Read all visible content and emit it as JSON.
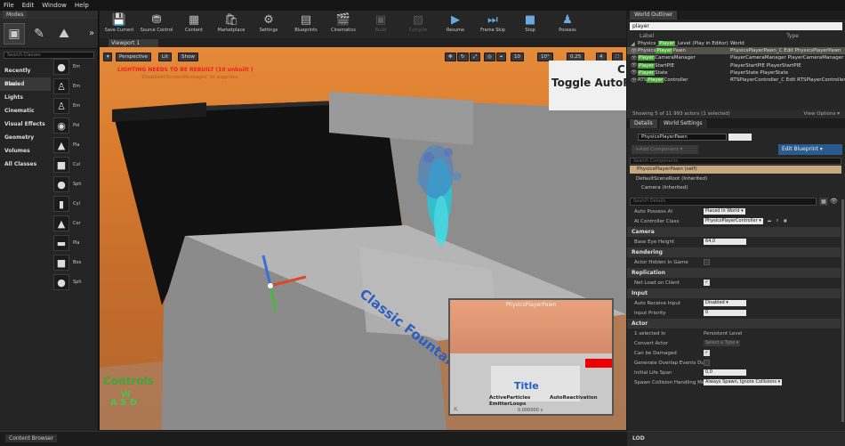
{
  "menu": [
    "File",
    "Edit",
    "Window",
    "Help"
  ],
  "modes": {
    "tab": "Modes",
    "search_placeholder": "Search Classes",
    "categories": [
      "Recently Placed",
      "Basic",
      "Lights",
      "Cinematic",
      "Visual Effects",
      "Geometry",
      "Volumes",
      "All Classes"
    ],
    "items": [
      {
        "icon": "●",
        "label": "Em"
      },
      {
        "icon": "♙",
        "label": "Em"
      },
      {
        "icon": "♙",
        "label": "Em"
      },
      {
        "icon": "◉",
        "label": "Poi"
      },
      {
        "icon": "▲",
        "label": "Pla"
      },
      {
        "icon": "■",
        "label": "Cul"
      },
      {
        "icon": "●",
        "label": "Sph"
      },
      {
        "icon": "▮",
        "label": "Cyl"
      },
      {
        "icon": "▲",
        "label": "Cor"
      },
      {
        "icon": "▬",
        "label": "Pla"
      },
      {
        "icon": "■",
        "label": "Box"
      },
      {
        "icon": "●",
        "label": "Sph"
      }
    ]
  },
  "toolbar": [
    {
      "icon": "💾",
      "label": "Save Current",
      "enabled": true
    },
    {
      "icon": "⛃",
      "label": "Source Control",
      "enabled": true
    },
    {
      "icon": "▦",
      "label": "Content",
      "enabled": true
    },
    {
      "icon": "🛍",
      "label": "Marketplace",
      "enabled": true
    },
    {
      "icon": "⚙",
      "label": "Settings",
      "enabled": true
    },
    {
      "icon": "▤",
      "label": "Blueprints",
      "enabled": true
    },
    {
      "icon": "🎬",
      "label": "Cinematics",
      "enabled": true
    },
    {
      "icon": "▣",
      "label": "Build",
      "enabled": false
    },
    {
      "icon": "▧",
      "label": "Compile",
      "enabled": false
    },
    {
      "icon": "▶",
      "label": "Resume",
      "enabled": true
    },
    {
      "icon": "⏭",
      "label": "Frame Skip",
      "enabled": true
    },
    {
      "icon": "■",
      "label": "Stop",
      "enabled": true
    },
    {
      "icon": "♟",
      "label": "Possess",
      "enabled": true
    }
  ],
  "viewport": {
    "tab": "Viewport 1",
    "perspective": "Perspective",
    "lit": "Lit",
    "show": "Show",
    "snap_move": "10",
    "snap_rot": "10°",
    "snap_scale": "0,25",
    "cam_speed": "4",
    "lighting_warning": "LIGHTING NEEDS TO BE REBUILT (10 unbuilt )",
    "lighting_sub": "'DisableAllScreenMessages' to suppress",
    "toggle_text": "Toggle AutoRe",
    "toggle_c": "C",
    "fountain_text": "Classic Fountai",
    "controls_title": "Controls",
    "wasd_w": "W",
    "wasd_asd": "A S D"
  },
  "pip": {
    "name": "PhysicsPlayerPawn",
    "title": "Title",
    "active_particles": "ActiveParticles",
    "emitter_loops": "EmitterLoops",
    "auto_reactivation": "AutoReactivation",
    "zero": "0,000000 s"
  },
  "outliner": {
    "tab": "World Outliner",
    "search": "player",
    "col_label": "Label",
    "col_type": "Type",
    "rows": [
      {
        "pre": "Physics_",
        "hl": "Player",
        "post": "_Level (Play in Editor)",
        "type": "World",
        "sel": false
      },
      {
        "pre": "Physics",
        "hl": "Player",
        "post": "Pawn",
        "type": "PhysicsPlayerPawn_C  Edit PhysicsPlayerPawn",
        "sel": true
      },
      {
        "pre": "",
        "hl": "Player",
        "post": "CameraManager",
        "type": "PlayerCameraManager  PlayerCameraManager",
        "sel": false
      },
      {
        "pre": "",
        "hl": "Player",
        "post": "StartPIE",
        "type": "PlayerStartPIE  PlayerStartPIE",
        "sel": false
      },
      {
        "pre": "",
        "hl": "Player",
        "post": "State",
        "type": "PlayerState  PlayerState",
        "sel": false
      },
      {
        "pre": "RTS",
        "hl": "Player",
        "post": "Controller",
        "type": "RTSPlayerController_C  Edit RTSPlayerController",
        "sel": false
      }
    ],
    "footer": "Showing 5 of 11 993 actors (1 selected)",
    "view_options": "View Options ▾"
  },
  "details": {
    "tab1": "Details",
    "tab2": "World Settings",
    "name": "PhysicsPlayerPawn",
    "add_component": "+Add Component ▾",
    "edit_blueprint": "Edit Blueprint ▾",
    "search_components": "Search Components",
    "self_comp": "PhysicsPlayerPawn (self)",
    "comp1": "DefaultSceneRoot (Inherited)",
    "comp2": "Camera (Inherited)",
    "search_details": "Search Details",
    "auto_possess_ai_k": "Auto Possess AI",
    "auto_possess_ai_v": "Placed in World ▾",
    "ai_controller_k": "AI Controller Class",
    "ai_controller_v": "PhysicsPlayerController ▾",
    "sec_camera": "Camera",
    "base_eye_k": "Base Eye Height",
    "base_eye_v": "64,0",
    "sec_rendering": "Rendering",
    "hidden_k": "Actor Hidden In Game",
    "sec_replication": "Replication",
    "net_load_k": "Net Load on Client",
    "sec_input": "Input",
    "auto_recv_k": "Auto Receive Input",
    "auto_recv_v": "Disabled ▾",
    "input_prio_k": "Input Priority",
    "input_prio_v": "0",
    "sec_actor": "Actor",
    "selected_k": "1 selected in",
    "selected_v": "Persistent Level",
    "convert_k": "Convert Actor",
    "convert_v": "Select a Type ▾",
    "damaged_k": "Can be Damaged",
    "overlap_k": "Generate Overlap Events Duri",
    "lifespan_k": "Initial Life Span",
    "lifespan_v": "0,0",
    "spawn_k": "Spawn Collision Handling Meth",
    "spawn_v": "Always Spawn, Ignore Collisions ▾"
  },
  "bottom": {
    "content_browser": "Content Browser",
    "lod": "LOD"
  }
}
